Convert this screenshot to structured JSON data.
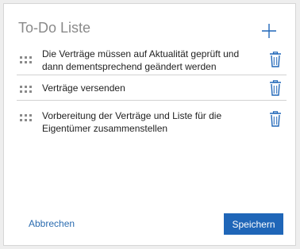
{
  "panel": {
    "title": "To-Do Liste",
    "add_icon": "plus-icon"
  },
  "todos": [
    {
      "text": "Die Verträge müssen auf Aktualität geprüft und dann dementsprechend geändert werden",
      "grip_icon": "drag-handle-icon",
      "delete_icon": "trash-icon"
    },
    {
      "text": "Verträge versenden",
      "grip_icon": "drag-handle-icon",
      "delete_icon": "trash-icon"
    },
    {
      "text": "Vorbereitung der Verträge und Liste für die Eigentümer zusammenstellen",
      "grip_icon": "drag-handle-icon",
      "delete_icon": "trash-icon"
    }
  ],
  "footer": {
    "cancel_label": "Abbrechen",
    "save_label": "Speichern"
  },
  "colors": {
    "accent": "#1f66b8",
    "link": "#2b6cb0",
    "icon": "#1f66b8",
    "grip": "#8a8a8a"
  }
}
